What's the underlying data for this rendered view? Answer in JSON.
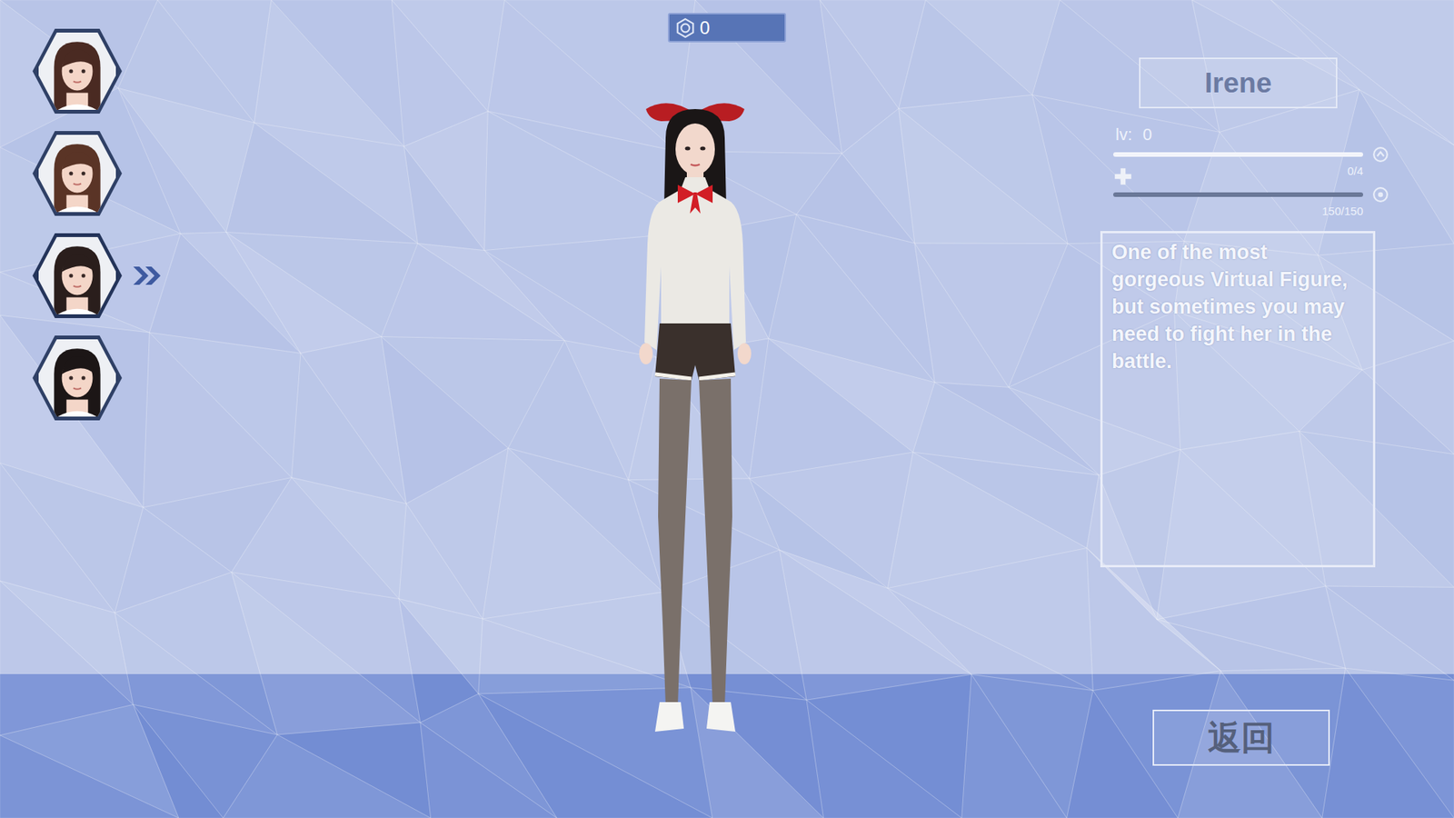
{
  "currency": {
    "amount": "0"
  },
  "characters": [
    {
      "selected": false
    },
    {
      "selected": false
    },
    {
      "selected": true
    },
    {
      "selected": false
    }
  ],
  "profile": {
    "name": "Irene",
    "level_label": "lv:",
    "level": "0",
    "exp": {
      "reading": "0/4",
      "level": 0
    },
    "hp": {
      "reading": "150/150",
      "level": 1
    },
    "description": "One of the most gorgeous Virtual Figure, but sometimes you may need to fight her in the battle."
  },
  "buttons": [
    "返回"
  ]
}
